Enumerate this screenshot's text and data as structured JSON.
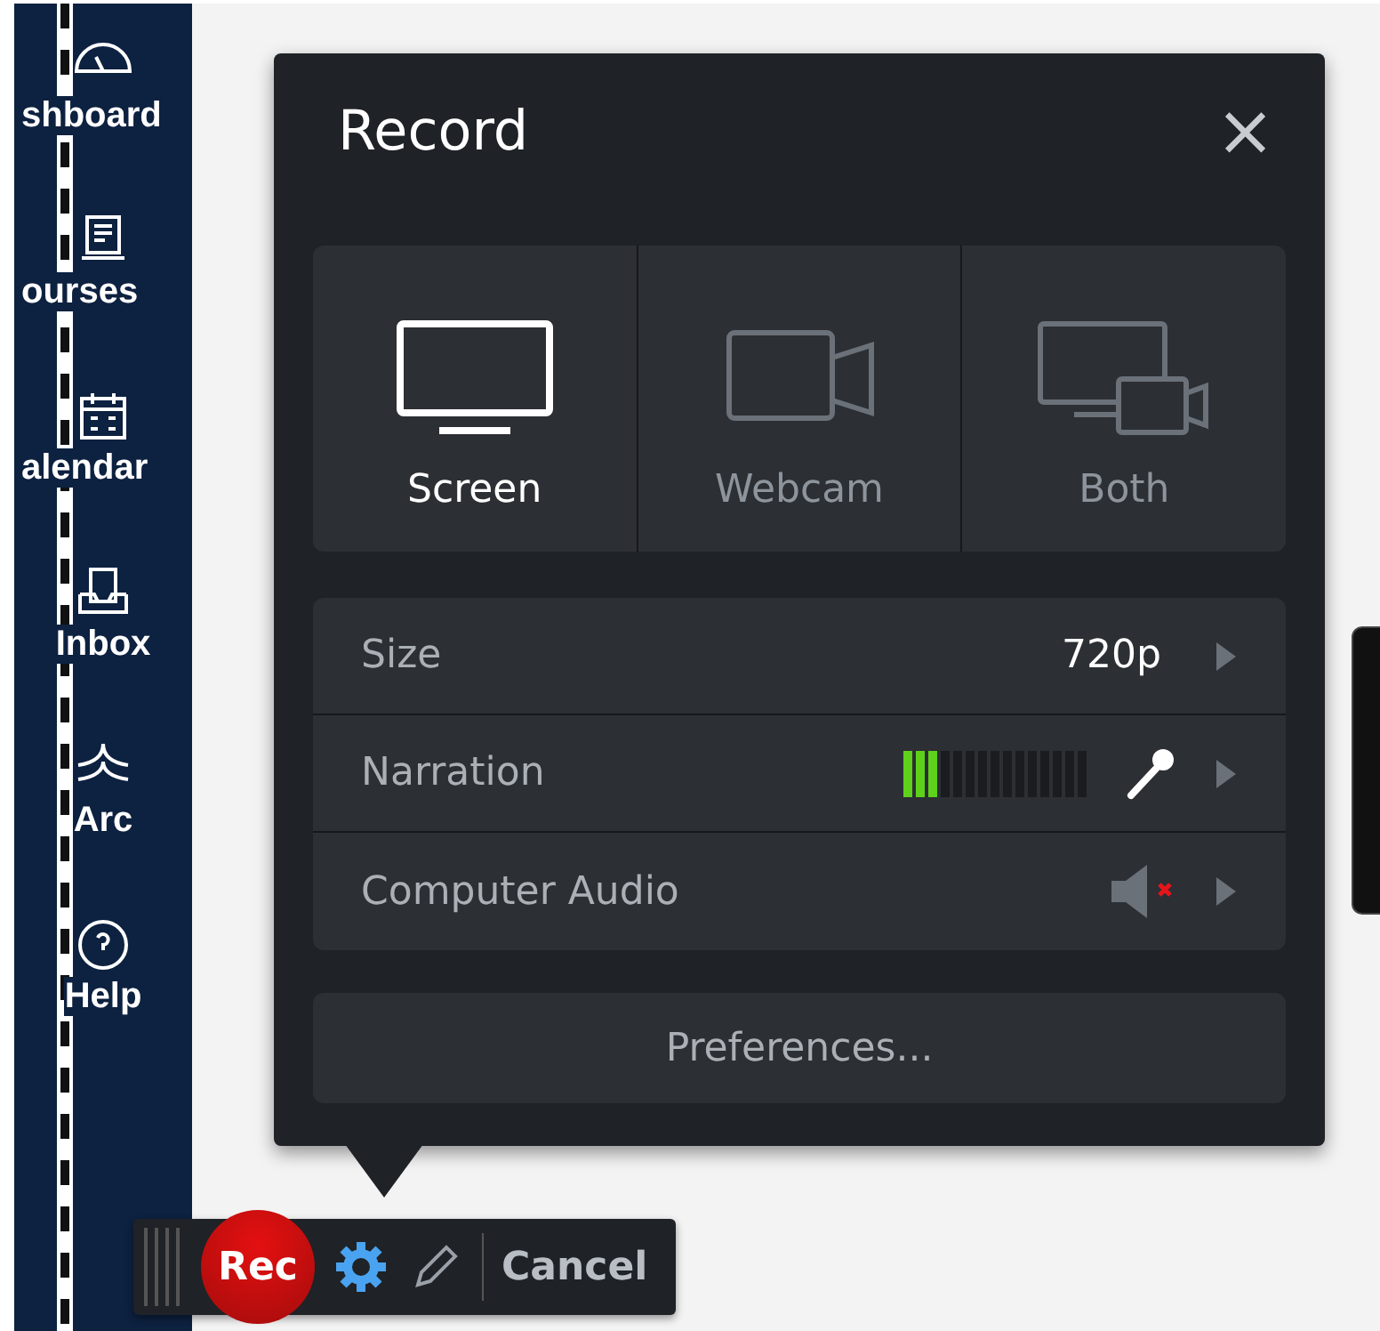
{
  "sidebar": {
    "items": [
      {
        "label": "shboard",
        "kind": "gauge"
      },
      {
        "label": "ourses",
        "kind": "courses"
      },
      {
        "label": "alendar",
        "kind": "calendar"
      },
      {
        "label": "Inbox",
        "kind": "inbox"
      },
      {
        "label": "Arc",
        "kind": "arc"
      },
      {
        "label": "Help",
        "kind": "help"
      }
    ]
  },
  "dialog": {
    "title": "Record",
    "close": "×",
    "modes": [
      {
        "label": "Screen",
        "kind": "screen",
        "selected": true
      },
      {
        "label": "Webcam",
        "kind": "webcam",
        "selected": false
      },
      {
        "label": "Both",
        "kind": "both",
        "selected": false
      }
    ],
    "settings": [
      {
        "label": "Size",
        "kind": "value",
        "value": "720p"
      },
      {
        "label": "Narration",
        "kind": "meter",
        "level": 0.2
      },
      {
        "label": "Computer Audio",
        "kind": "audio",
        "muted": true
      }
    ],
    "preferences": "Preferences..."
  },
  "toolbar": {
    "rec": "Rec",
    "cancel": "Cancel"
  }
}
